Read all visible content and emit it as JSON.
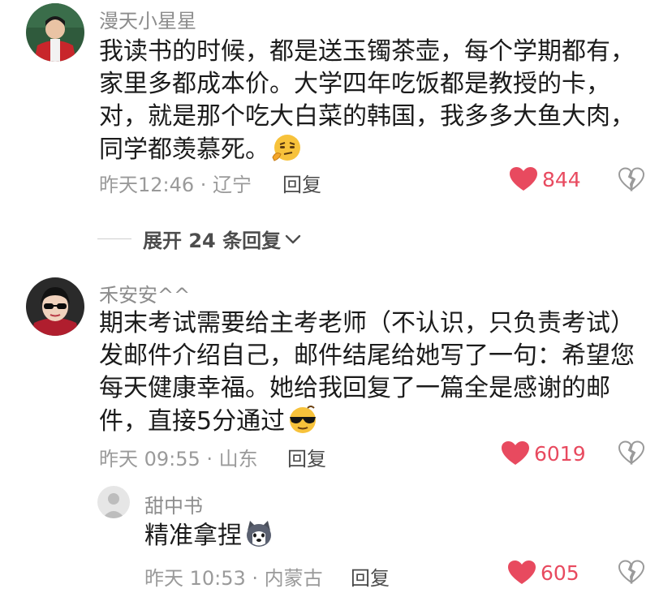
{
  "comments": [
    {
      "username": "漫天小星星",
      "lines": [
        "我读书的时候，都是送玉镯茶壶，每个学期都有，",
        "家里多都成本价。大学四年吃饭都是教授的卡，",
        "对，就是那个吃大白菜的韩国，我多多大鱼大肉，",
        "同学都羡慕死。"
      ],
      "emoji": "thinking-face-icon",
      "time_location": "昨天12:46 · 辽宁",
      "reply_label": "回复",
      "likes": "844",
      "expand_label": "展开 24 条回复"
    },
    {
      "username": "禾安安^^",
      "lines": [
        "期末考试需要给主考老师（不认识，只负责考试）",
        "发邮件介绍自己，邮件结尾给她写了一句：希望您",
        "每天健康幸福。她给我回复了一篇全是感谢的邮",
        "件，直接5分通过"
      ],
      "emoji": "sunglasses-face-icon",
      "time_location": "昨天 09:55 · 山东",
      "reply_label": "回复",
      "likes": "6019"
    }
  ],
  "nested_reply": {
    "username": "甜中书",
    "text": "精准拿捏",
    "emoji": "husky-dog-icon",
    "time_location": "昨天 10:53 · 内蒙古",
    "reply_label": "回复",
    "likes": "605"
  },
  "colors": {
    "like_red": "#e84a5f",
    "meta_gray": "#9a9a9a"
  }
}
